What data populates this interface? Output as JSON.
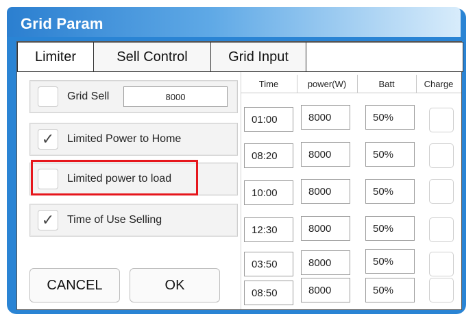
{
  "window": {
    "title": "Grid Param"
  },
  "tabs": [
    {
      "label": "Limiter"
    },
    {
      "label": "Sell Control"
    },
    {
      "label": "Grid Input"
    }
  ],
  "limiter": {
    "grid_sell": {
      "label": "Grid Sell",
      "value": "8000",
      "checked": false
    },
    "limited_power_to_home": {
      "label": "Limited Power to Home",
      "checked": true
    },
    "limited_power_to_load": {
      "label": "Limited power to load",
      "checked": false
    },
    "time_of_use_selling": {
      "label": "Time of Use Selling",
      "checked": true
    },
    "check_glyph": "✓"
  },
  "buttons": {
    "cancel": "CANCEL",
    "ok": "OK"
  },
  "schedule": {
    "headers": [
      "Time",
      "power(W)",
      "Batt",
      "Charge"
    ],
    "rows": [
      {
        "time": "01:00",
        "power": "8000",
        "batt": "50%",
        "charge": false
      },
      {
        "time": "08:20",
        "power": "8000",
        "batt": "50%",
        "charge": false
      },
      {
        "time": "10:00",
        "power": "8000",
        "batt": "50%",
        "charge": false
      },
      {
        "time": "12:30",
        "power": "8000",
        "batt": "50%",
        "charge": false
      },
      {
        "time": "03:50",
        "power": "8000",
        "batt": "50%",
        "charge": false
      },
      {
        "time": "08:50",
        "power": "8000",
        "batt": "50%",
        "charge": false
      }
    ]
  },
  "colors": {
    "accent": "#2a84d4",
    "highlight": "#e6161c"
  }
}
